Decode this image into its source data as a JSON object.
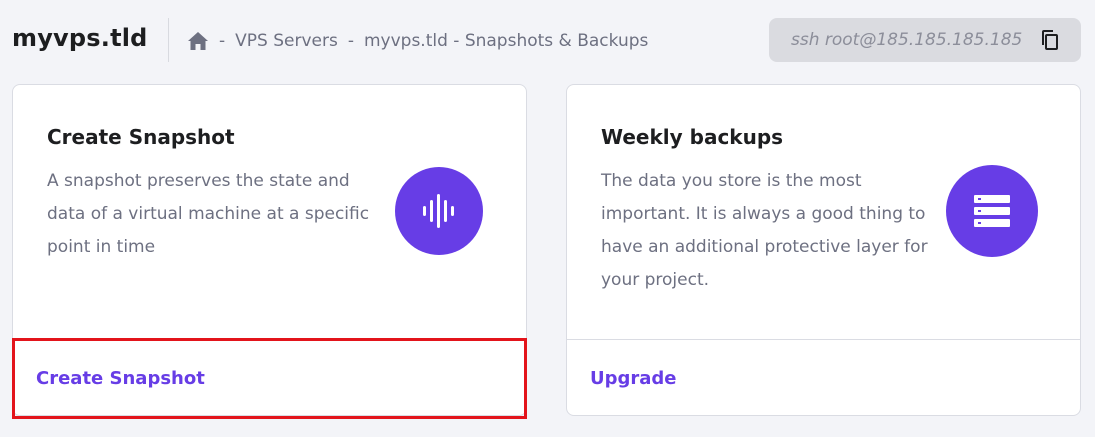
{
  "header": {
    "site_title": "myvps.tld",
    "breadcrumb": {
      "home_icon": "home-icon",
      "separator": "-",
      "items": [
        "VPS Servers",
        "myvps.tld - Snapshots & Backups"
      ]
    },
    "ssh": {
      "command": "ssh root@185.185.185.185",
      "copy_icon": "copy-icon"
    }
  },
  "cards": [
    {
      "title": "Create Snapshot",
      "description": "A snapshot preserves the state and data of a virtual machine at a specific point in time",
      "icon": "audio-wave-icon",
      "action_label": "Create Snapshot"
    },
    {
      "title": "Weekly backups",
      "description": "The data you store is the most important. It is always a good thing to have an additional protective layer for your project.",
      "icon": "server-stack-icon",
      "action_label": "Upgrade"
    }
  ],
  "colors": {
    "accent": "#673de6",
    "highlight": "#e3141b",
    "background": "#f3f4f8"
  }
}
